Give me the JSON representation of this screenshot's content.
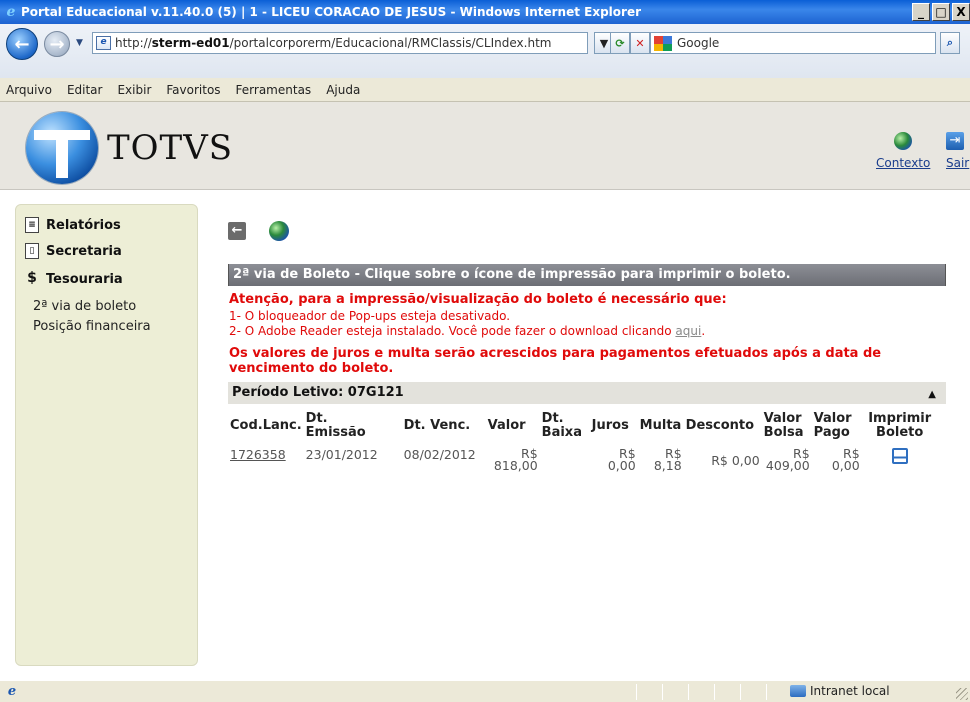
{
  "window": {
    "title": "Portal Educacional v.11.40.0 (5) | 1 - LICEU CORACAO DE JESUS - Windows Internet Explorer",
    "min": "_",
    "max": "□",
    "close": "X"
  },
  "address": {
    "url_prefix": "http://",
    "url_host": "sterm-ed01",
    "url_path": "/portalcorporerm/Educacional/RMClassis/CLIndex.htm",
    "search_placeholder": "Google"
  },
  "menu": [
    "Arquivo",
    "Editar",
    "Exibir",
    "Favoritos",
    "Ferramentas",
    "Ajuda"
  ],
  "header": {
    "brand": "TOTVS",
    "context_label": "Contexto",
    "exit_label": "Sair"
  },
  "sidebar": {
    "sections": [
      {
        "label": "Relatórios",
        "icon": "report-icon"
      },
      {
        "label": "Secretaria",
        "icon": "clipboard-icon"
      },
      {
        "label": "Tesouraria",
        "icon": "dollar-icon"
      }
    ],
    "subitems": [
      "2ª via de boleto",
      "Posição financeira"
    ]
  },
  "content": {
    "section_title": "2ª via de Boleto - Clique sobre o ícone de impressão para imprimir o boleto.",
    "warning_title": "Atenção, para a impressão/visualização do boleto é necessário que:",
    "warning_1": "1- O bloqueador de Pop-ups esteja desativado.",
    "warning_2_text": "2- O Adobe Reader esteja instalado. Você pode fazer o download clicando ",
    "warning_2_link": "aqui",
    "warning_2_end": ".",
    "interest_note_1": "Os valores de juros e multa serão acrescidos para pagamentos efetuados após a data de",
    "interest_note_2": "vencimento do boleto.",
    "period_label": "Período Letivo: 07G121"
  },
  "table": {
    "headers": {
      "cod": "Cod.Lanc.",
      "emissao_1": "Dt.",
      "emissao_2": "Emissão",
      "venc": "Dt. Venc.",
      "valor": "Valor",
      "baixa_1": "Dt.",
      "baixa_2": "Baixa",
      "juros": "Juros",
      "multa": "Multa",
      "desconto": "Desconto",
      "bolsa_1": "Valor",
      "bolsa_2": "Bolsa",
      "pago_1": "Valor",
      "pago_2": "Pago",
      "imprimir_1": "Imprimir",
      "imprimir_2": "Boleto"
    },
    "rows": [
      {
        "cod": "1726358",
        "emissao": "23/01/2012",
        "venc": "08/02/2012",
        "valor_cur": "R$",
        "valor": "818,00",
        "baixa": "",
        "juros_cur": "R$",
        "juros": "0,00",
        "multa_cur": "R$",
        "multa": "8,18",
        "desconto": "R$ 0,00",
        "bolsa_cur": "R$",
        "bolsa": "409,00",
        "pago_cur": "R$",
        "pago": "0,00"
      }
    ]
  },
  "status": {
    "zone": "Intranet local"
  }
}
